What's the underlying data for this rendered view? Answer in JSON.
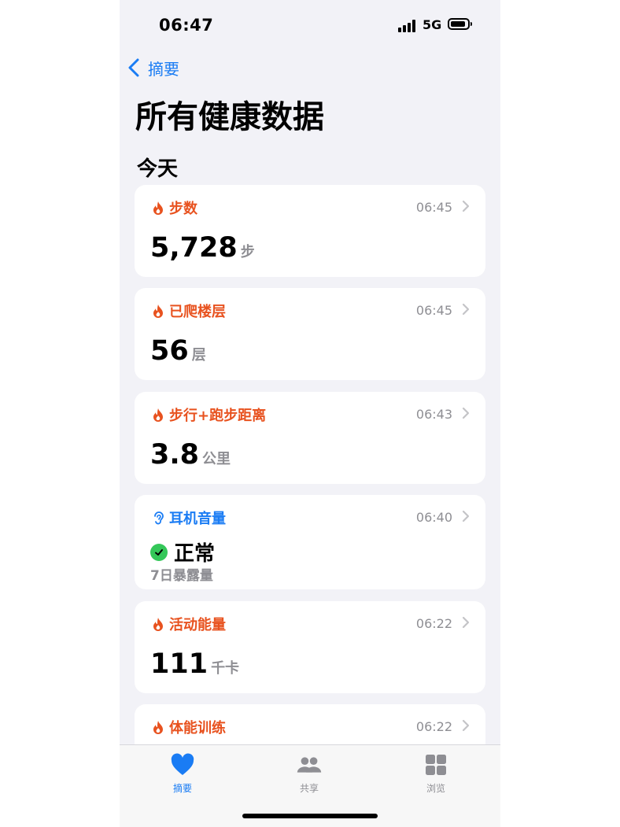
{
  "status_bar": {
    "time": "06:47",
    "network": "5G"
  },
  "nav": {
    "back_label": "摘要"
  },
  "page": {
    "title": "所有健康数据",
    "section": "今天"
  },
  "colors": {
    "activity": "#e8521f",
    "hearing": "#1a7cf4",
    "tab_active": "#1a7cf4",
    "tab_inactive": "#8e8e93",
    "ok": "#34c759"
  },
  "cards": [
    {
      "label": "步数",
      "time": "06:45",
      "value": "5,728",
      "unit": "步",
      "icon": "flame-icon"
    },
    {
      "label": "已爬楼层",
      "time": "06:45",
      "value": "56",
      "unit": "层",
      "icon": "flame-icon"
    },
    {
      "label": "步行+跑步距离",
      "time": "06:43",
      "value": "3.8",
      "unit": "公里",
      "icon": "flame-icon"
    },
    {
      "label": "耳机音量",
      "time": "06:40",
      "status": "正常",
      "note": "7日暴露量",
      "icon": "ear-icon"
    },
    {
      "label": "活动能量",
      "time": "06:22",
      "value": "111",
      "unit": "千卡",
      "icon": "flame-icon"
    },
    {
      "label": "体能训练",
      "time": "06:22",
      "icon": "flame-icon"
    }
  ],
  "tabs": [
    {
      "label": "摘要",
      "icon": "heart-icon",
      "active": true
    },
    {
      "label": "共享",
      "icon": "people-icon",
      "active": false
    },
    {
      "label": "浏览",
      "icon": "grid-icon",
      "active": false
    }
  ]
}
